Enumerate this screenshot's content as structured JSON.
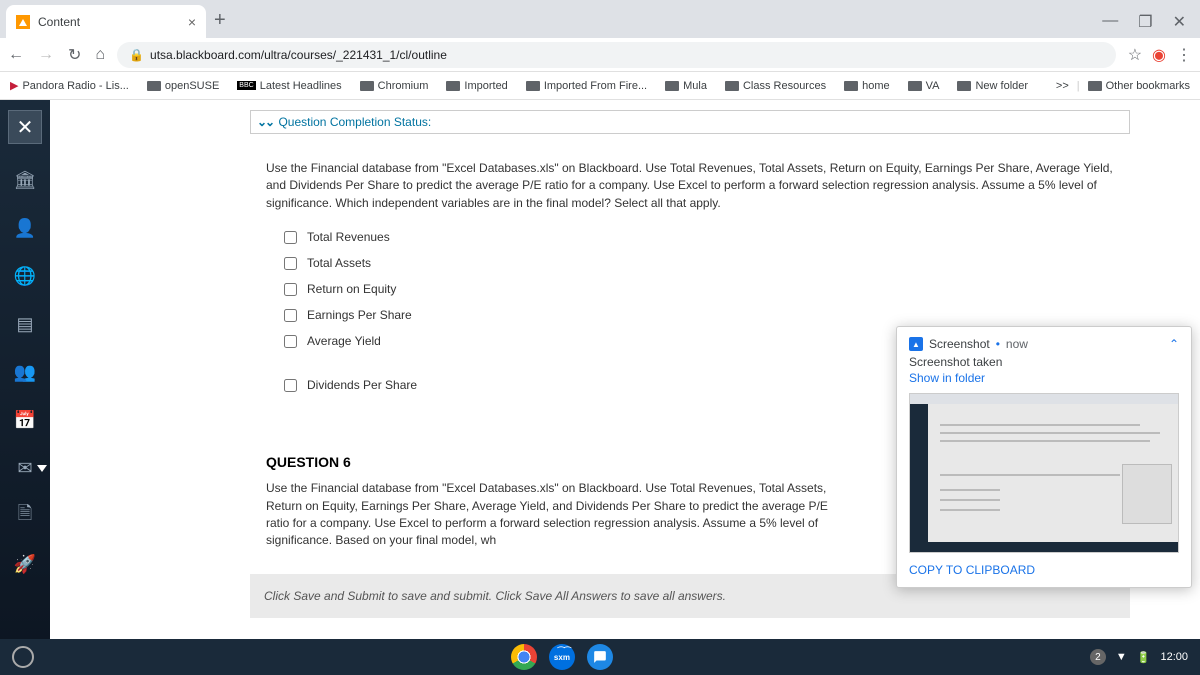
{
  "tab": {
    "title": "Content"
  },
  "url": "utsa.blackboard.com/ultra/courses/_221431_1/cl/outline",
  "bookmarks": {
    "items": [
      "Pandora Radio - Lis...",
      "openSUSE",
      "Latest Headlines",
      "Chromium",
      "Imported",
      "Imported From Fire...",
      "Mula",
      "Class Resources",
      "home",
      "VA",
      "New folder"
    ],
    "expand": ">>",
    "other": "Other bookmarks"
  },
  "question_status_label": "Question Completion Status:",
  "q5": {
    "text": "Use the Financial database from \"Excel Databases.xls\" on Blackboard.  Use Total Revenues, Total Assets, Return on Equity, Earnings Per Share, Average Yield, and Dividends Per Share to predict the average P/E ratio for a company.   Use Excel to perform a forward selection regression analysis.   Assume a 5% level of significance.   Which independent variables are in the final model?   Select all that apply.",
    "options": [
      "Total Revenues",
      "Total Assets",
      "Return on Equity",
      "Earnings Per Share",
      "Average Yield",
      "Dividends Per Share"
    ]
  },
  "q6": {
    "title": "QUESTION 6",
    "text": "Use the Financial database from \"Excel Databases.xls\" on Blackboard.   Use Total Revenues, Total Assets, Return on Equity, Earnings Per Share, Average Yield, and Dividends Per Share to predict the average P/E ratio for a company.   Use Excel to perform a forward selection regression analysis.  Assume a 5% level of significance.  Based on your final model, wh"
  },
  "submit_hint": "Click Save and Submit to save and submit. Click Save All Answers to save all answers.",
  "notif": {
    "app": "Screenshot",
    "sep": " • ",
    "time": "now",
    "title": "Screenshot taken",
    "action": "Show in folder",
    "copy": "COPY TO CLIPBOARD"
  },
  "taskbar": {
    "badge": "2",
    "time": "12:00",
    "sxm": "sxm"
  }
}
